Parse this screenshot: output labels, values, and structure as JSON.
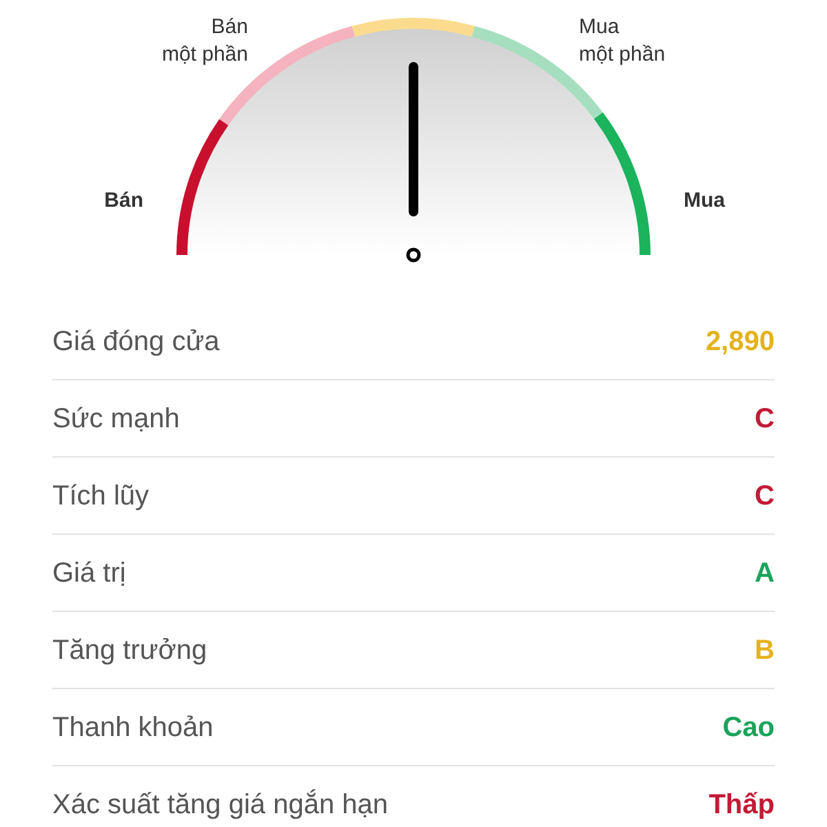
{
  "gauge": {
    "needle": {
      "kind": "middle"
    },
    "segments": [
      {
        "label": "Bán",
        "color": "#c8102e"
      },
      {
        "label": "Bán một phần",
        "color": "#f4b3be"
      },
      {
        "color": "#fbdc8e"
      },
      {
        "label": "Mua một phần",
        "color": "#a6dfc0"
      },
      {
        "label": "Mua",
        "color": "#1bb35c"
      }
    ]
  },
  "rows": [
    {
      "label": "Giá đóng cửa",
      "value": "2,890",
      "color": "#e3b21c"
    },
    {
      "label": "Sức mạnh",
      "value": "C",
      "color": "#c21a35"
    },
    {
      "label": "Tích lũy",
      "value": "C",
      "color": "#c21a35"
    },
    {
      "label": "Giá trị",
      "value": "A",
      "color": "#1aa35a"
    },
    {
      "label": "Tăng trưởng",
      "value": "B",
      "color": "#e3b21c"
    },
    {
      "label": "Thanh khoản",
      "value": "Cao",
      "color": "#1aa35a"
    },
    {
      "label": "Xác suất tăng giá ngắn hạn",
      "value": "Thấp",
      "color": "#c21a35"
    }
  ]
}
